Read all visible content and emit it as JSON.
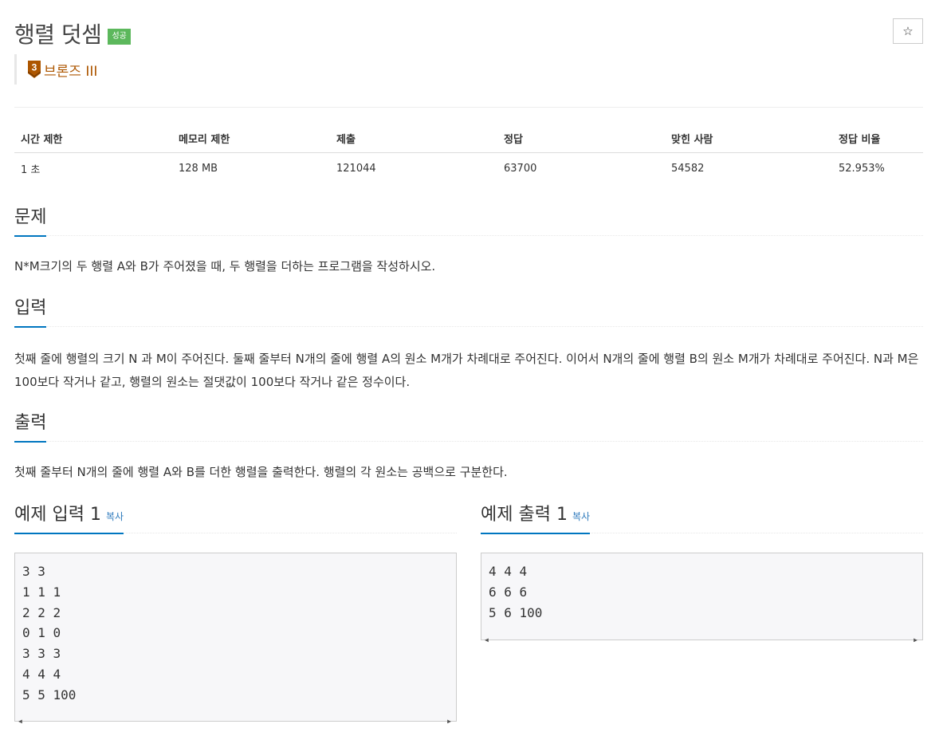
{
  "problem": {
    "title": "행렬 덧셈",
    "status_badge": "성공",
    "tier_number": "3",
    "tier_label": "브론즈 III",
    "star_icon": "star-outline-icon",
    "colors": {
      "success": "#5cb85c",
      "tier": "#ad5600",
      "accent": "#0076c0",
      "link": "#2f7bbd"
    }
  },
  "stats": {
    "headers": [
      "시간 제한",
      "메모리 제한",
      "제출",
      "정답",
      "맞힌 사람",
      "정답 비율"
    ],
    "values": [
      "1 초",
      "128 MB",
      "121044",
      "63700",
      "54582",
      "52.953%"
    ]
  },
  "sections": {
    "problem_title": "문제",
    "problem_text": "N*M크기의 두 행렬 A와 B가 주어졌을 때, 두 행렬을 더하는 프로그램을 작성하시오.",
    "input_title": "입력",
    "input_text": "첫째 줄에 행렬의 크기 N 과 M이 주어진다. 둘째 줄부터 N개의 줄에 행렬 A의 원소 M개가 차례대로 주어진다. 이어서 N개의 줄에 행렬 B의 원소 M개가 차례대로 주어진다. N과 M은 100보다 작거나 같고, 행렬의 원소는 절댓값이 100보다 작거나 같은 정수이다.",
    "output_title": "출력",
    "output_text": "첫째 줄부터 N개의 줄에 행렬 A와 B를 더한 행렬을 출력한다. 행렬의 각 원소는 공백으로 구분한다."
  },
  "samples": {
    "input_title": "예제 입력 1",
    "output_title": "예제 출력 1",
    "copy_label": "복사",
    "input_lines": [
      "3 3",
      "1 1 1",
      "2 2 2",
      "0 1 0",
      "3 3 3",
      "4 4 4",
      "5 5 100"
    ],
    "output_lines": [
      "4 4 4",
      "6 6 6",
      "5 6 100"
    ]
  }
}
